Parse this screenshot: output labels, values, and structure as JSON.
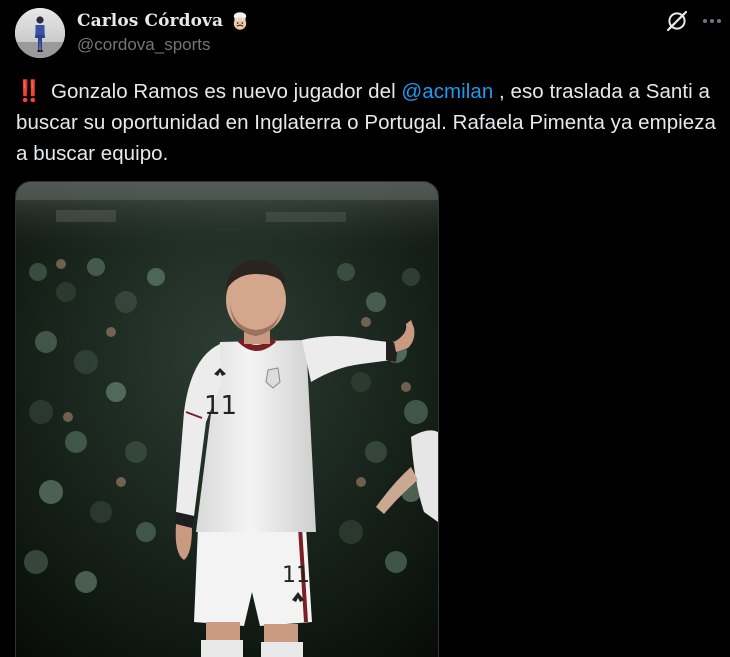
{
  "tweet": {
    "author": {
      "name": "Carlos Córdova",
      "handle": "@cordova_sports",
      "emoji_icon": "chef-face-emoji",
      "avatar_icon": "avatar-person-standing"
    },
    "actions": {
      "grok_icon": "grok-icon",
      "more_icon": "more-icon"
    },
    "text": {
      "lead_icon": "‼️",
      "part1": "Gonzalo Ramos es nuevo jugador del ",
      "mention": "@acmilan",
      "part2": " , eso traslada a Santi a buscar su oportunidad en Inglaterra o Portugal. Rafaela Pimenta ya empieza a buscar equipo."
    },
    "media": {
      "jersey_number": "11"
    }
  },
  "colors": {
    "background": "#000000",
    "text_primary": "#e7e9ea",
    "text_secondary": "#71767b",
    "link": "#1d9bf0",
    "bang": "#e3262f"
  }
}
